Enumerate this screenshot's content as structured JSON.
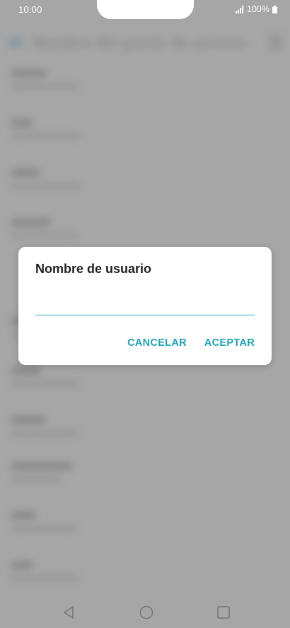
{
  "status_bar": {
    "time": "10:00",
    "battery": "100%",
    "icons": [
      "signal-icon",
      "battery-icon"
    ]
  },
  "background_app": {
    "title": "Nombre del punto de acceso"
  },
  "dialog": {
    "title": "Nombre de usuario",
    "input_value": "",
    "cancel_label": "CANCELAR",
    "accept_label": "ACEPTAR"
  },
  "nav_bar": {
    "icons": [
      "back-icon",
      "home-icon",
      "recent-apps-icon"
    ]
  },
  "colors": {
    "accent": "#1ea1b3",
    "scrim": "#a6a6a6",
    "dialog_bg": "#ffffff",
    "title_text": "#222222"
  }
}
